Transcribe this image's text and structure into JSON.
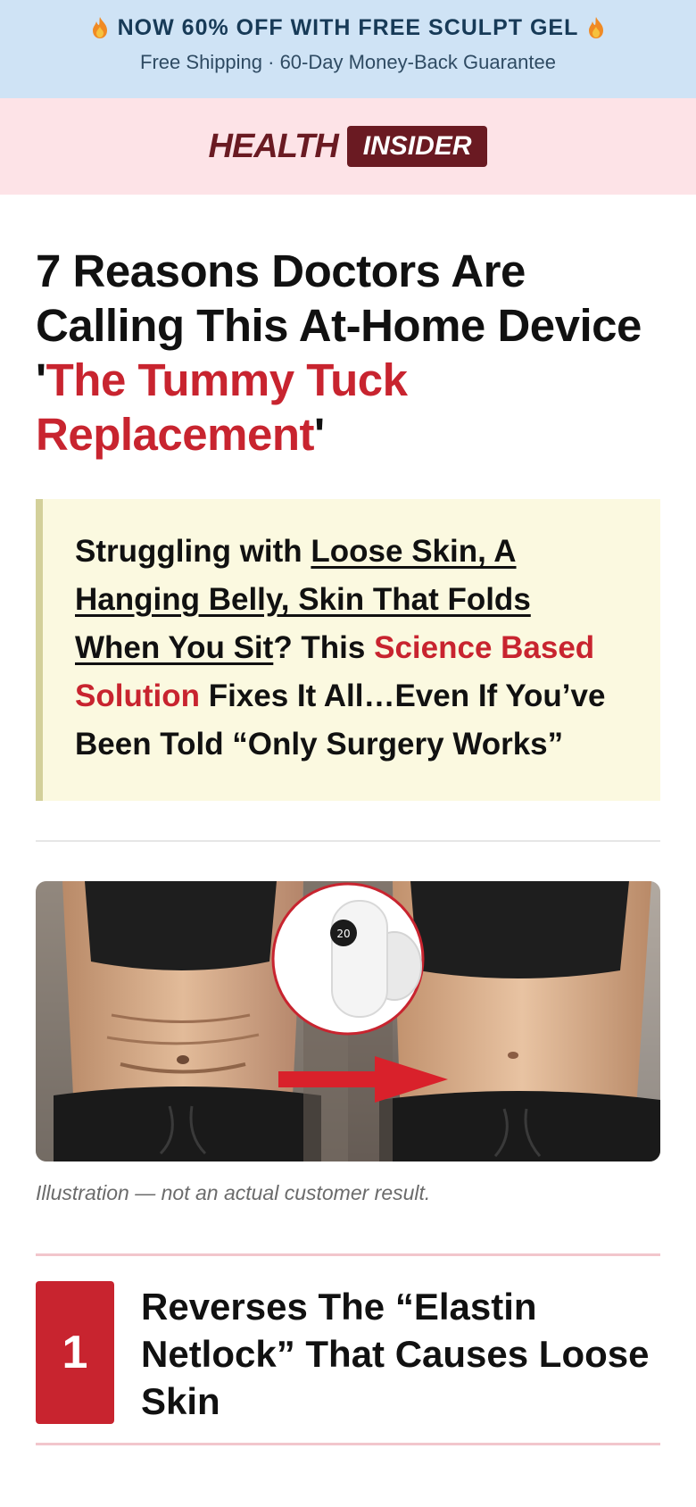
{
  "promo": {
    "headline": "NOW 60% OFF WITH FREE SCULPT GEL",
    "subline": "Free Shipping · 60-Day Money-Back Guarantee",
    "icon": "fire-icon"
  },
  "brand": {
    "word1": "HEALTH",
    "word2": "INSIDER"
  },
  "article": {
    "headline_part1": "7 Reasons Doctors Are Calling This At-Home Device '",
    "headline_highlight": "The Tummy Tuck Replacement",
    "headline_part2": "'",
    "callout": {
      "lead": "Struggling with ",
      "underlined": "Loose Skin, A Hanging Belly, Skin That Folds When You Sit",
      "mid": "? This ",
      "highlight": "Science Based Solution",
      "tail": " Fixes It All…Even If You’ve Been Told “Only Surgery Works”"
    },
    "hero_image": {
      "device_display": "20"
    },
    "caption": "Illustration — not an actual customer result.",
    "reasons": [
      {
        "number": "1",
        "title": "Reverses The “Elastin Netlock” That Causes Loose Skin"
      }
    ]
  },
  "colors": {
    "promo_bg": "#cfe3f5",
    "brand_bg": "#fde3e7",
    "brand_dark": "#6a1a22",
    "accent_red": "#c8242f",
    "callout_bg": "#fbf9e0"
  }
}
